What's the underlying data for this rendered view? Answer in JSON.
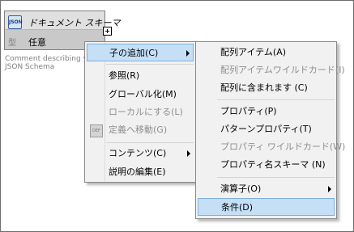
{
  "node": {
    "title": "ドキュメント スキーマ",
    "icon": "json-schema-icon",
    "type_icon_label": "型",
    "type_value": "任意",
    "comment_lines": [
      "Comment describing y",
      "JSON Schema"
    ]
  },
  "context_menu": {
    "items": [
      {
        "label": "子の追加(C)",
        "submenu": true,
        "active": true
      },
      {
        "label": "参照(R)"
      },
      {
        "label": "グローバル化(M)"
      },
      {
        "label": "ローカルにする(L)",
        "disabled": true
      },
      {
        "label": "定義へ移動(G)",
        "disabled": true
      },
      {
        "label": "コンテンツ(C)",
        "submenu": true
      },
      {
        "label": "説明の編集(E)"
      }
    ]
  },
  "submenu": {
    "items": [
      {
        "label": "配列アイテム(A)"
      },
      {
        "label": "配列アイテムワイルドカード(I)",
        "disabled": true
      },
      {
        "label": "配列に含まれます (C)"
      },
      {
        "label": "プロパティ(P)"
      },
      {
        "label": "パターンプロパティ(T)"
      },
      {
        "label": "プロパティ ワイルドカード(W)",
        "disabled": true
      },
      {
        "label": "プロパティ名スキーマ (N)"
      },
      {
        "label": "演算子(O)",
        "submenu": true
      },
      {
        "label": "条件(D)",
        "active": true
      }
    ]
  }
}
